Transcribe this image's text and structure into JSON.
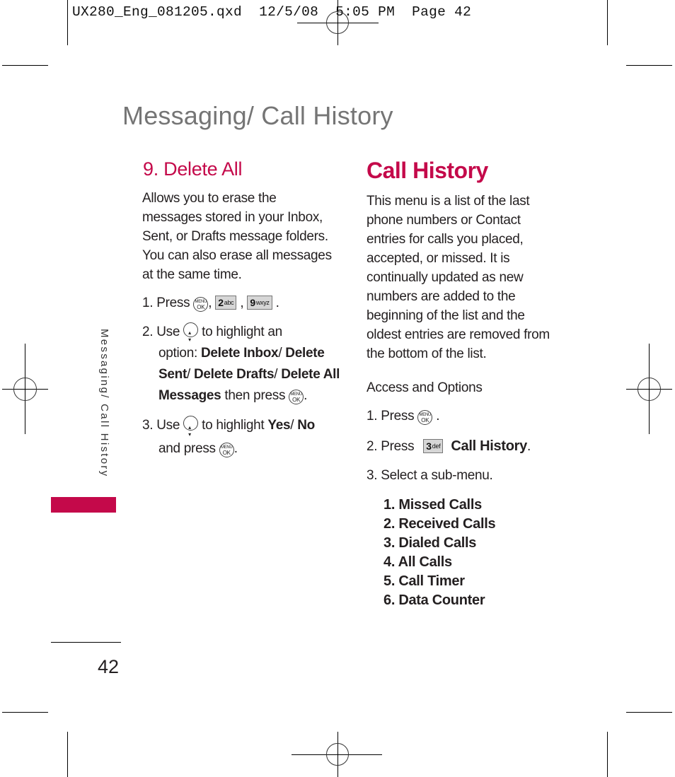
{
  "slug": {
    "file": "UX280_Eng_081205.qxd",
    "date": "12/5/08",
    "time": "5:05 PM",
    "page_label": "Page 42"
  },
  "page_title": "Messaging/ Call History",
  "side_tab": "Messaging/ Call History",
  "page_number": "42",
  "colors": {
    "accent": "#c4094a",
    "title_gray": "#757575",
    "text": "#231f20"
  },
  "left": {
    "heading": "9. Delete All",
    "intro": "Allows you to erase the messages stored in your Inbox, Sent, or Drafts message folders. You can also erase all messages at the same time.",
    "steps": [
      {
        "num": "1. Press",
        "keys": [
          {
            "type": "menu-ok",
            "top": "MENU",
            "bottom": "OK"
          },
          {
            "type": "keycap",
            "digit": "2",
            "letters": "abc"
          },
          {
            "type": "keycap",
            "digit": "9",
            "letters": "wxyz"
          }
        ]
      },
      {
        "num": "2. Use",
        "text_a": "to highlight an",
        "text_b": "option:",
        "options": [
          "Delete Inbox",
          "Delete Sent",
          "Delete Drafts",
          "Delete All Messages"
        ],
        "sep": "/",
        "text_c": "then press"
      },
      {
        "num": "3. Use",
        "text_a": "to highlight",
        "yes": "Yes",
        "no": "No",
        "text_b": "and press"
      }
    ]
  },
  "right": {
    "heading": "Call History",
    "intro": "This menu is a list of the last phone numbers or Contact entries for calls you placed, accepted, or missed. It is continually updated as new numbers are added to the beginning of the list and the oldest entries are removed from the bottom of the list.",
    "subheading": "Access and Options",
    "steps": [
      {
        "num": "1. Press",
        "key": {
          "type": "menu-ok",
          "top": "MENU",
          "bottom": "OK"
        }
      },
      {
        "num": "2. Press",
        "key": {
          "type": "keycap",
          "digit": "3",
          "letters": "def"
        },
        "target": "Call History"
      },
      {
        "num": "3. Select a sub-menu."
      }
    ],
    "submenu": [
      "1. Missed Calls",
      "2. Received Calls",
      "3. Dialed Calls",
      "4. All Calls",
      "5. Call Timer",
      "6. Data Counter"
    ]
  }
}
